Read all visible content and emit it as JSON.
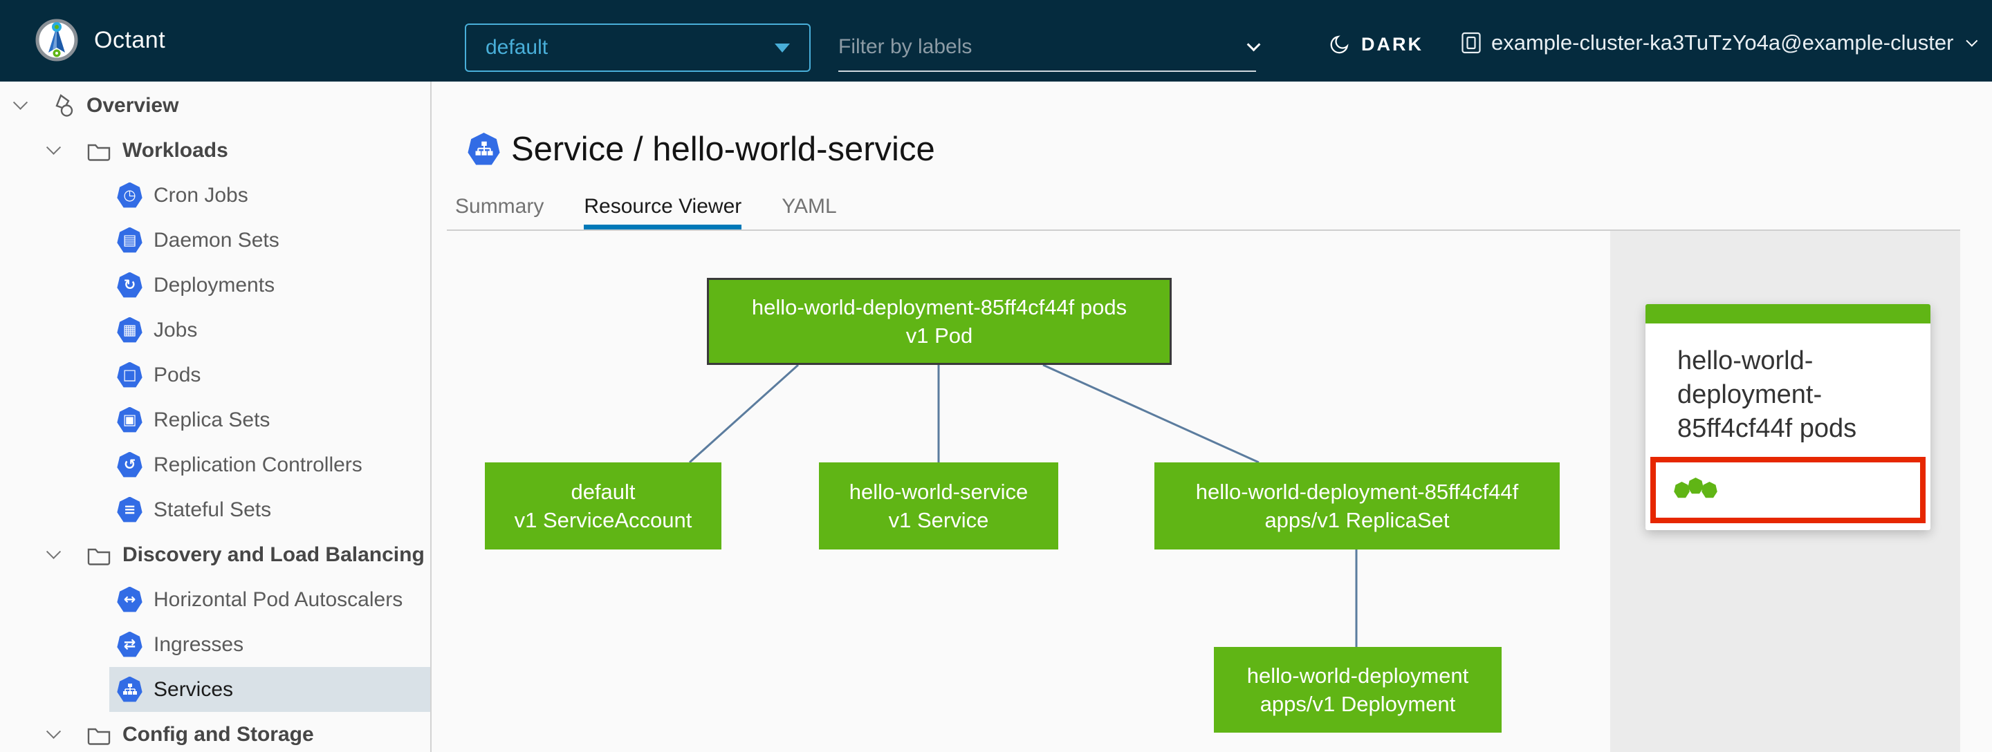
{
  "header": {
    "app_title": "Octant",
    "namespace_selector": {
      "value": "default",
      "icon": "dropdown-arrow-icon"
    },
    "filter": {
      "placeholder": "Filter by labels",
      "icon": "chevron-down-icon"
    },
    "theme_toggle": {
      "label": "DARK",
      "icon": "moon-icon"
    },
    "cluster_selector": {
      "value": "example-cluster-ka3TuTzYo4a@example-cluster",
      "icon": "cluster-icon"
    }
  },
  "sidebar": {
    "items": [
      {
        "label": "Overview",
        "level": 1,
        "icon": "applications-icon",
        "expanded": true
      },
      {
        "label": "Workloads",
        "level": 2,
        "icon": "folder-icon",
        "expanded": true
      },
      {
        "label": "Cron Jobs",
        "level": 3,
        "icon": "k8s-cronjobs-icon",
        "glyph": "◷"
      },
      {
        "label": "Daemon Sets",
        "level": 3,
        "icon": "k8s-daemonsets-icon",
        "glyph": "▤"
      },
      {
        "label": "Deployments",
        "level": 3,
        "icon": "k8s-deployments-icon",
        "glyph": "↻"
      },
      {
        "label": "Jobs",
        "level": 3,
        "icon": "k8s-jobs-icon",
        "glyph": "▦"
      },
      {
        "label": "Pods",
        "level": 3,
        "icon": "k8s-pods-icon",
        "glyph": "□"
      },
      {
        "label": "Replica Sets",
        "level": 3,
        "icon": "k8s-replicasets-icon",
        "glyph": "▣"
      },
      {
        "label": "Replication Controllers",
        "level": 3,
        "icon": "k8s-replicationcontrollers-icon",
        "glyph": "↺"
      },
      {
        "label": "Stateful Sets",
        "level": 3,
        "icon": "k8s-statefulsets-icon",
        "glyph": "≡"
      },
      {
        "label": "Discovery and Load Balancing",
        "level": 2,
        "icon": "folder-icon",
        "expanded": true
      },
      {
        "label": "Horizontal Pod Autoscalers",
        "level": 3,
        "icon": "k8s-hpa-icon",
        "glyph": "↔"
      },
      {
        "label": "Ingresses",
        "level": 3,
        "icon": "k8s-ingresses-icon",
        "glyph": "⇄"
      },
      {
        "label": "Services",
        "level": 3,
        "icon": "k8s-services-icon",
        "selected": true
      },
      {
        "label": "Config and Storage",
        "level": 2,
        "icon": "folder-icon",
        "expanded": true
      }
    ]
  },
  "main": {
    "title": {
      "kind_icon": "service-kind-icon",
      "text": "Service / hello-world-service"
    },
    "tabs": [
      {
        "label": "Summary",
        "active": false
      },
      {
        "label": "Resource Viewer",
        "active": true
      },
      {
        "label": "YAML",
        "active": false
      }
    ]
  },
  "graph": {
    "nodes": [
      {
        "id": "pod",
        "name": "hello-world-deployment-85ff4cf44f pods",
        "kind": "v1 Pod",
        "selected": true
      },
      {
        "id": "serviceaccount",
        "name": "default",
        "kind": "v1 ServiceAccount",
        "selected": false
      },
      {
        "id": "service",
        "name": "hello-world-service",
        "kind": "v1 Service",
        "selected": false
      },
      {
        "id": "replicaset",
        "name": "hello-world-deployment-85ff4cf44f",
        "kind": "apps/v1 ReplicaSet",
        "selected": false
      },
      {
        "id": "deployment",
        "name": "hello-world-deployment",
        "kind": "apps/v1 Deployment",
        "selected": false
      }
    ],
    "edges": [
      {
        "from": "pod",
        "to": "serviceaccount"
      },
      {
        "from": "pod",
        "to": "service"
      },
      {
        "from": "pod",
        "to": "replicaset"
      },
      {
        "from": "replicaset",
        "to": "deployment"
      }
    ]
  },
  "detail_panel": {
    "card": {
      "title": "hello-world-deployment-85ff4cf44f pods",
      "status_dots": 3,
      "status_color": "#60b515",
      "highlight_color": "#e62700"
    }
  },
  "colors": {
    "header_bg": "#052B3E",
    "accent_blue": "#49afd9",
    "tab_underline": "#0079b8",
    "k8s_icon_blue": "#326ce5",
    "node_green": "#60b515",
    "edge_gray_blue": "#5b7c9e",
    "highlight_red": "#e62700",
    "panel_bg": "#ebebeb",
    "selected_row_bg": "#d9e1e7"
  }
}
